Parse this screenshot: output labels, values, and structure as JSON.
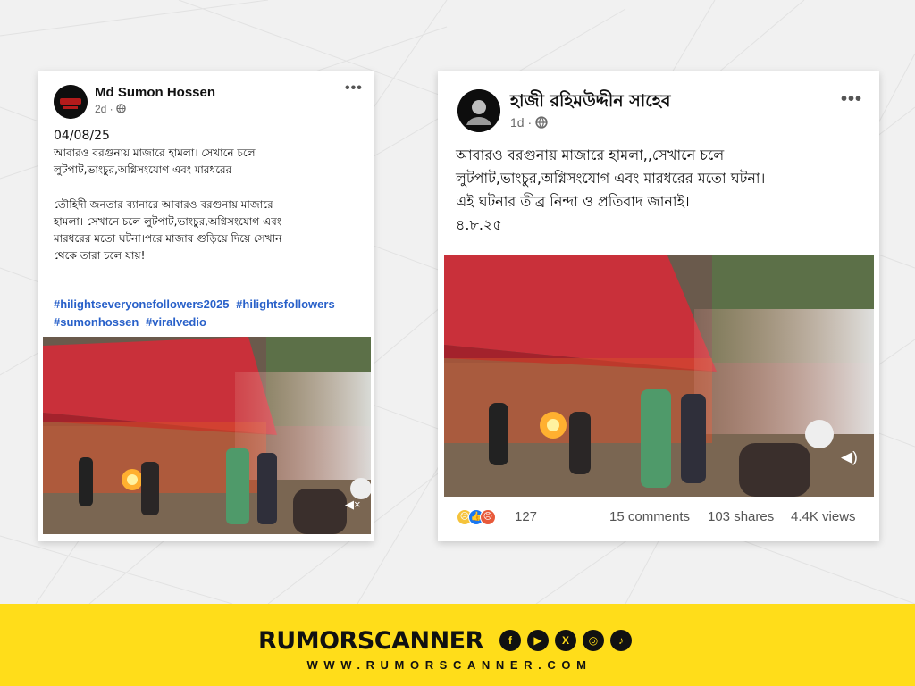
{
  "left_post": {
    "author": "Md Sumon Hossen",
    "time": "2d · ",
    "date": "04/08/25",
    "text_1": "আবারও বরগুনায় মাজারে হামলা। সেখানে চলে\nলুটপাট,ভাংচুর,অগ্নিসংযোগ এবং মারধরের",
    "text_2": "তৌহিদী জনতার ব্যানারে আবারও বরগুনায় মাজারে\nহামলা। সেখানে চলে লুটপাট,ভাংচুর,অগ্নিসংযোগ এবং\nমারধরের মতো ঘটনা।পরে মাজার গুড়িয়ে দিয়ে সেখান\nথেকে তারা চলে যায়!",
    "hashtags": [
      "#hilightseveryonefollowers2025",
      "#hilightsfollowers",
      "#sumonhossen",
      "#viralvedio"
    ],
    "more_icon": "more-dots-icon",
    "globe_icon": "globe-icon",
    "mute_icon": "muted-speaker-icon"
  },
  "right_post": {
    "author": "হাজী রহিমউদ্দীন সাহেব",
    "time": "1d · ",
    "text": "আবারও বরগুনায় মাজারে হামলা,,সেখানে চলে\nলুটপাট,ভাংচুর,অগ্নিসংযোগ এবং মারধরের মতো ঘটনা।\nএই ঘটনার তীব্র নিন্দা ও প্রতিবাদ জানাই।\n৪.৮.২৫",
    "reaction_count": "127",
    "comments": "15 comments",
    "shares": "103 shares",
    "views": "4.4K views",
    "more_icon": "more-dots-icon",
    "globe_icon": "globe-icon",
    "speaker_icon": "speaker-icon"
  },
  "footer": {
    "brand": "RUMORSCANNER",
    "url": "WWW.RUMORSCANNER.COM",
    "social_icons": [
      "facebook-icon",
      "youtube-icon",
      "x-icon",
      "instagram-icon",
      "tiktok-icon"
    ],
    "background": "#ffdd1a"
  },
  "colors": {
    "hashtag": "#2860c9",
    "awning": "#c9303a"
  }
}
